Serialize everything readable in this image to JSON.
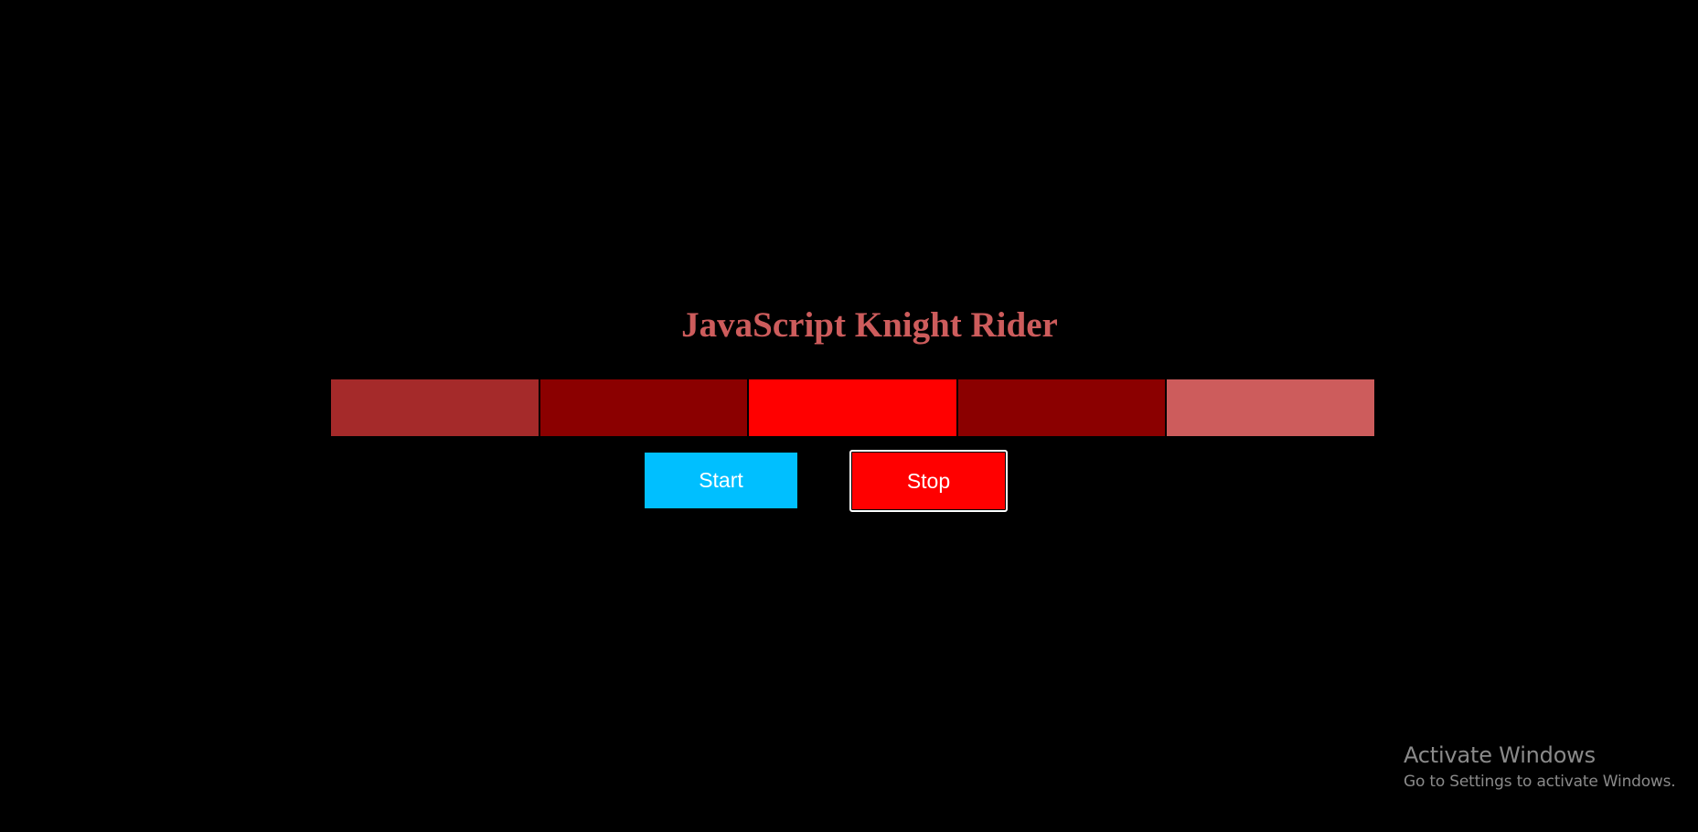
{
  "title": {
    "text": "JavaScript Knight Rider",
    "color": "#cd5c5c"
  },
  "lights": [
    {
      "name": "light-1",
      "color": "#a52a2a"
    },
    {
      "name": "light-2",
      "color": "#8b0000"
    },
    {
      "name": "light-3",
      "color": "#ff0000"
    },
    {
      "name": "light-4",
      "color": "#8b0000"
    },
    {
      "name": "light-5",
      "color": "#cd5c5c"
    }
  ],
  "buttons": {
    "start": {
      "label": "Start",
      "color": "#00bfff"
    },
    "stop": {
      "label": "Stop",
      "color": "#ff0000"
    }
  },
  "watermark": {
    "title": "Activate Windows",
    "subtitle": "Go to Settings to activate Windows."
  }
}
